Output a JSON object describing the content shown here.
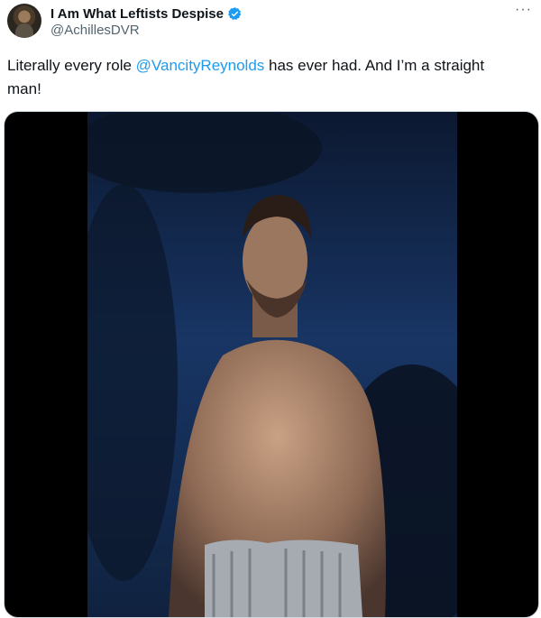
{
  "author": {
    "display_name": "I Am What Leftists Despise",
    "handle": "@AchillesDVR",
    "verified": true
  },
  "more_label": "···",
  "tweet": {
    "text_before": "Literally every role ",
    "mention": "@VancityReynolds",
    "text_after": " has ever had. And I’m a straight man!"
  },
  "colors": {
    "accent": "#1d9bf0",
    "secondary_text": "#536471",
    "media_background": "#000000"
  }
}
